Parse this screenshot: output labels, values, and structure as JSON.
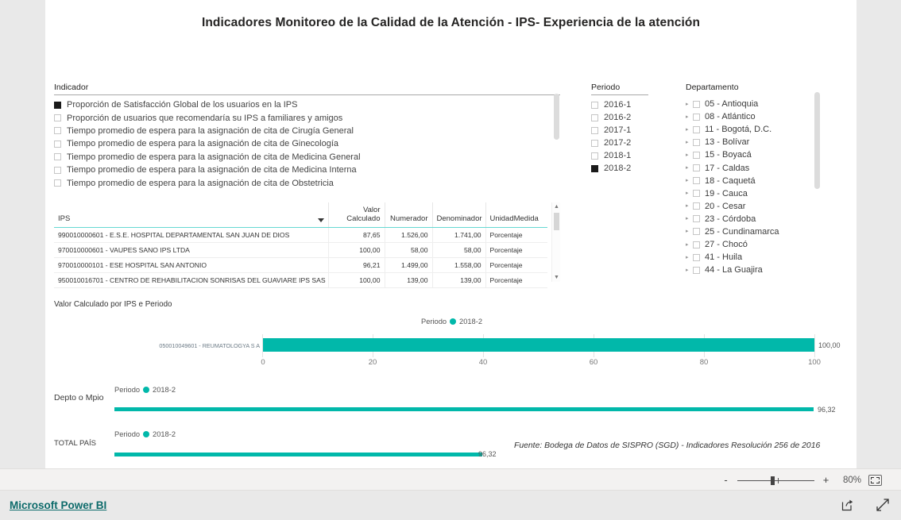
{
  "report": {
    "title": "Indicadores Monitoreo de la Calidad de la Atención - IPS- Experiencia de la atención",
    "source_note": "Fuente: Bodega de Datos de SISPRO (SGD) - Indicadores Resolución 256 de 2016",
    "accent_color": "#01B8AA"
  },
  "indicador_slicer": {
    "header": "Indicador",
    "items": [
      {
        "label": "Proporción de Satisfacción Global de los usuarios en la IPS",
        "checked": true
      },
      {
        "label": "Proporción de usuarios que recomendaría su IPS a familiares y amigos",
        "checked": false
      },
      {
        "label": "Tiempo promedio de espera para la asignación de cita de Cirugía General",
        "checked": false
      },
      {
        "label": "Tiempo promedio de espera para la asignación de cita de Ginecología",
        "checked": false
      },
      {
        "label": "Tiempo promedio de espera para la asignación de cita de Medicina General",
        "checked": false
      },
      {
        "label": "Tiempo promedio de espera para la asignación de cita de Medicina Interna",
        "checked": false
      },
      {
        "label": "Tiempo promedio de espera para la asignación de cita de Obstetricia",
        "checked": false
      }
    ]
  },
  "periodo_slicer": {
    "header": "Periodo",
    "items": [
      {
        "label": "2016-1",
        "checked": false
      },
      {
        "label": "2016-2",
        "checked": false
      },
      {
        "label": "2017-1",
        "checked": false
      },
      {
        "label": "2017-2",
        "checked": false
      },
      {
        "label": "2018-1",
        "checked": false
      },
      {
        "label": "2018-2",
        "checked": true
      }
    ]
  },
  "departamento_slicer": {
    "header": "Departamento",
    "items": [
      {
        "label": "05 - Antioquia",
        "checked": false
      },
      {
        "label": "08 - Atlántico",
        "checked": false
      },
      {
        "label": "11 - Bogotá, D.C.",
        "checked": false
      },
      {
        "label": "13 - Bolívar",
        "checked": false
      },
      {
        "label": "15 - Boyacá",
        "checked": false
      },
      {
        "label": "17 - Caldas",
        "checked": false
      },
      {
        "label": "18 - Caquetá",
        "checked": false
      },
      {
        "label": "19 - Cauca",
        "checked": false
      },
      {
        "label": "20 - Cesar",
        "checked": false
      },
      {
        "label": "23 - Córdoba",
        "checked": false
      },
      {
        "label": "25 - Cundinamarca",
        "checked": false
      },
      {
        "label": "27 - Chocó",
        "checked": false
      },
      {
        "label": "41 - Huila",
        "checked": false
      },
      {
        "label": "44 - La Guajira",
        "checked": false
      }
    ]
  },
  "ips_table": {
    "columns": [
      "IPS",
      "Valor Calculado",
      "Numerador",
      "Denominador",
      "UnidadMedida"
    ],
    "rows": [
      [
        "990010000601 - E.S.E. HOSPITAL DEPARTAMENTAL SAN JUAN DE DIOS",
        "87,65",
        "1.526,00",
        "1.741,00",
        "Porcentaje"
      ],
      [
        "970010000601 - VAUPES SANO IPS LTDA",
        "100,00",
        "58,00",
        "58,00",
        "Porcentaje"
      ],
      [
        "970010000101 - ESE HOSPITAL SAN ANTONIO",
        "96,21",
        "1.499,00",
        "1.558,00",
        "Porcentaje"
      ],
      [
        "950010016701 - CENTRO DE REHABILITACION SONRISAS DEL GUAVIARE IPS SAS",
        "100,00",
        "139,00",
        "139,00",
        "Porcentaje"
      ]
    ]
  },
  "chart_data": [
    {
      "type": "bar",
      "name": "valor-por-ips",
      "title": "Valor Calculado por IPS e Periodo",
      "legend_title": "Periodo",
      "legend_position": "top",
      "series": [
        {
          "name": "2018-2",
          "color": "#01B8AA",
          "values": [
            100.0
          ]
        }
      ],
      "categories": [
        "050010049601 - REUMATOLOGYA S A"
      ],
      "data_labels": [
        "100,00"
      ],
      "xlabel": "",
      "ylabel": "",
      "xlim": [
        0,
        100
      ],
      "xticks": [
        "0",
        "20",
        "40",
        "60",
        "80",
        "100"
      ],
      "grid": true
    },
    {
      "type": "bar",
      "name": "depto-o-mpio",
      "title": "Depto o Mpio",
      "legend_title": "Periodo",
      "legend_position": "top",
      "series": [
        {
          "name": "2018-2",
          "color": "#01B8AA",
          "values": [
            96.32
          ]
        }
      ],
      "categories": [
        ""
      ],
      "data_labels": [
        "96,32"
      ],
      "xlim": [
        0,
        100
      ],
      "xticks": [],
      "grid": false
    },
    {
      "type": "bar",
      "name": "total-pais",
      "title": "TOTAL PAÍS",
      "legend_title": "Periodo",
      "legend_position": "top",
      "series": [
        {
          "name": "2018-2",
          "color": "#01B8AA",
          "values": [
            96.32
          ]
        }
      ],
      "categories": [
        ""
      ],
      "data_labels": [
        "96,32"
      ],
      "xlim": [
        0,
        200
      ],
      "xticks": [],
      "grid": false
    }
  ],
  "toolbar": {
    "zoom_out_label": "-",
    "zoom_in_label": "+",
    "zoom_level": "80%"
  },
  "footer": {
    "brand_link": "Microsoft Power BI",
    "share_icon": "share-icon",
    "fullscreen_icon": "fullscreen-icon"
  }
}
